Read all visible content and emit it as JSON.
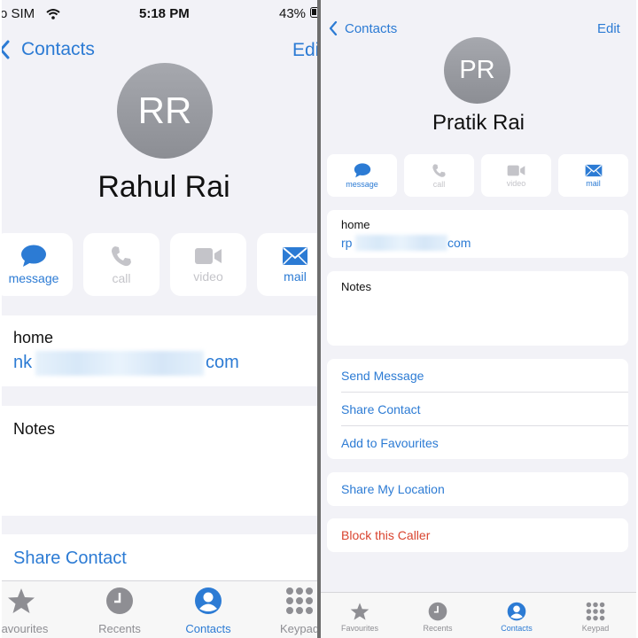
{
  "left": {
    "status": {
      "carrier": "o SIM",
      "time": "5:18 PM",
      "battery": "43%"
    },
    "nav": {
      "back_label": "Contacts",
      "edit_label": "Edi"
    },
    "contact": {
      "initials": "RR",
      "name": "Rahul Rai"
    },
    "actions": [
      {
        "label": "message",
        "icon": "message-icon",
        "enabled": true
      },
      {
        "label": "call",
        "icon": "phone-icon",
        "enabled": false
      },
      {
        "label": "video",
        "icon": "video-icon",
        "enabled": false
      },
      {
        "label": "mail",
        "icon": "mail-icon",
        "enabled": true
      }
    ],
    "email": {
      "label": "home",
      "value_start": "nk",
      "value_end": "com"
    },
    "notes_label": "Notes",
    "share_contact": "Share Contact",
    "tabs": [
      {
        "label": "Favourites",
        "icon": "star-icon",
        "active": false
      },
      {
        "label": "Recents",
        "icon": "clock-icon",
        "active": false
      },
      {
        "label": "Contacts",
        "icon": "person-circle-icon",
        "active": true
      },
      {
        "label": "Keypad",
        "icon": "keypad-icon",
        "active": false
      }
    ]
  },
  "right": {
    "nav": {
      "back_label": "Contacts",
      "edit_label": "Edit"
    },
    "contact": {
      "initials": "PR",
      "name": "Pratik Rai"
    },
    "actions": [
      {
        "label": "message",
        "icon": "message-icon",
        "enabled": true
      },
      {
        "label": "call",
        "icon": "phone-icon",
        "enabled": false
      },
      {
        "label": "video",
        "icon": "video-icon",
        "enabled": false
      },
      {
        "label": "mail",
        "icon": "mail-icon",
        "enabled": true
      }
    ],
    "email": {
      "label": "home",
      "value_start": "rp",
      "value_end": "com"
    },
    "notes_label": "Notes",
    "menu": [
      "Send Message",
      "Share Contact",
      "Add to Favourites"
    ],
    "share_location": "Share My Location",
    "block_caller": "Block this Caller",
    "tabs": [
      {
        "label": "Favourites",
        "icon": "star-icon",
        "active": false
      },
      {
        "label": "Recents",
        "icon": "clock-icon",
        "active": false
      },
      {
        "label": "Contacts",
        "icon": "person-circle-icon",
        "active": true
      },
      {
        "label": "Keypad",
        "icon": "keypad-icon",
        "active": false
      }
    ]
  },
  "colors": {
    "accent": "#2c7bd4",
    "disabled": "#c4c4c9",
    "danger": "#d9442f",
    "background": "#f2f2f7"
  }
}
